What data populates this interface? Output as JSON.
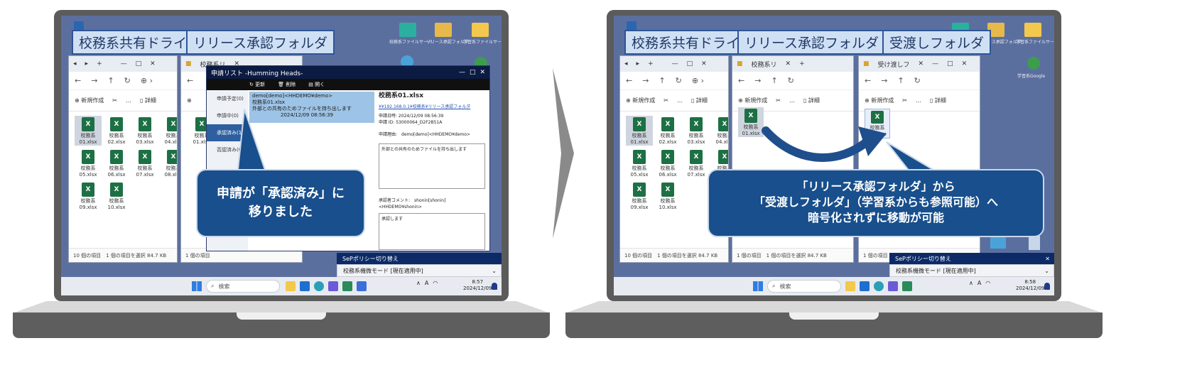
{
  "folders": {
    "shared_drive": "校務系共有ドライブ",
    "release_approval": "リリース承認フォルダ",
    "transfer": "受渡しフォルダ"
  },
  "explorer": {
    "new_label": "新規作成",
    "more_label": "…",
    "details_label": "詳細",
    "tab_label": "校務系リ",
    "tab_label_transfer": "受け渡しフ",
    "status_left": "10 個の項目　1 個の項目を選択 84.7 KB",
    "status_small": "1 個の項目",
    "status_small2": "1 個の項目　1 個の項目を選択 84.7 KB",
    "files": [
      "校務系\n01.xlsx",
      "校務系\n02.xlsx",
      "校務系\n03.xlsx",
      "校務系\n04.xlsx",
      "校務系\n05.xlsx",
      "校務系\n06.xlsx",
      "校務系\n07.xlsx",
      "校務系\n08.xlsx",
      "校務系\n09.xlsx",
      "校務系\n10.xlsx"
    ],
    "single_file": "校務系\n01.xlsx"
  },
  "dialog": {
    "title": "申請リスト -Humming Heads-",
    "toolbar": [
      "更新",
      "削除",
      "開く"
    ],
    "left_items": [
      "申請予定(0)",
      "申請中(0)",
      "承認済み(1)",
      "否認済み(0)"
    ],
    "entry_user": "demo[demo]<HHDEMO¥demo>",
    "entry_file": "校務系01.xlsx",
    "entry_reason": "外部との共有のためファイルを持ち出します",
    "entry_date": "2024/12/09 08:56:39",
    "detail_title": "校務系01.xlsx",
    "detail_path": "¥¥192.168.0.1¥校務系¥リリース承認フォルダ",
    "detail_date": "申請日時: 2024/12/09 08:56:39",
    "detail_id": "申請 ID: 53000064_D2F2B51A",
    "detail_applicant": "申請理由:　demo[demo]<HHDEMO¥demo>",
    "detail_reason": "外部との共有のためファイルを持ち出します",
    "approver_comment_label": "承認者コメント:　shonin[shonin]<HHDEMO¥shonin>",
    "approver_comment": "承認します"
  },
  "callouts": {
    "left_line1": "申請が「承認済み」に",
    "left_line2": "移りました",
    "right_line1": "「リリース承認フォルダ」から",
    "right_line2": "「受渡しフォルダ」（学習系からも参照可能）へ",
    "right_line3": "暗号化されずに移動が可能"
  },
  "policy": {
    "title": "SePポリシー切り替え",
    "mode": "校務系機微モード [現在適用中]"
  },
  "taskbar": {
    "search_placeholder": "検索",
    "time_left": "8:57",
    "date_left": "2024/12/09",
    "time_right": "8:58",
    "date_right": "2024/12/09",
    "ime": "A"
  },
  "desktop": {
    "icon_labels": [
      "校務系ファイルサーバ",
      "リリース承認フォルダ",
      "学習系ファイルサーバ"
    ],
    "browser_label": "学習系Google"
  },
  "colors": {
    "bezel": "#5b5b5b",
    "screen": "#5b6f9f",
    "callout": "#184f8c",
    "arrow": "#1f4e8c",
    "excel": "#1d7044"
  }
}
